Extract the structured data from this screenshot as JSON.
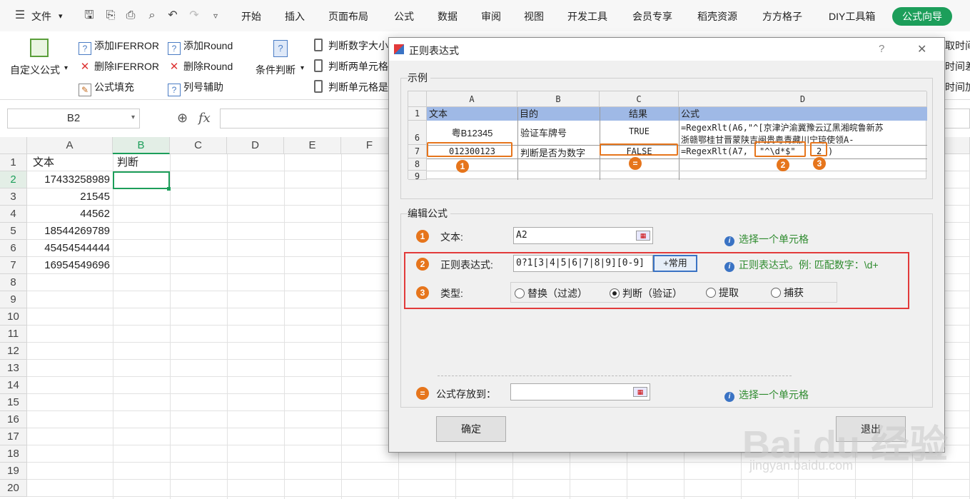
{
  "menubar": {
    "file": "文件",
    "tabs": [
      "开始",
      "插入",
      "页面布局",
      "公式",
      "数据",
      "审阅",
      "视图",
      "开发工具",
      "会员专享",
      "稻壳资源",
      "方方格子",
      "DIY工具箱"
    ],
    "active_tab": "公式向导"
  },
  "ribbon": {
    "custom_formula": "自定义公式",
    "add_iferror": "添加IFERROR",
    "del_iferror": "删除IFERROR",
    "formula_fill": "公式填充",
    "add_round": "添加Round",
    "del_round": "删除Round",
    "col_helper": "列号辅助",
    "cond_judge": "条件判断",
    "judge_num": "判断数字大小",
    "judge_two": "判断两单元格",
    "judge_cell": "判断单元格是",
    "r1": "取时间",
    "r2": "时间差",
    "r3": "时间加"
  },
  "formula_bar": {
    "name_box": "B2",
    "fx": "fx"
  },
  "sheet": {
    "columns": [
      "A",
      "B",
      "C",
      "D",
      "E",
      "F"
    ],
    "rows": [
      "1",
      "2",
      "3",
      "4",
      "5",
      "6",
      "7",
      "8",
      "9",
      "10",
      "11",
      "12",
      "13",
      "14",
      "15",
      "16",
      "17",
      "18",
      "19",
      "20"
    ],
    "header_a": "文本",
    "header_b": "判断",
    "values": [
      "17433258989",
      "21545",
      "44562",
      "18544269789",
      "45454544444",
      "16954549696"
    ]
  },
  "dialog": {
    "title": "正则表达式",
    "help": "?",
    "close": "✕",
    "example_label": "示例",
    "example": {
      "cols": [
        "A",
        "B",
        "C",
        "D"
      ],
      "row_nums": [
        "1",
        "6",
        "7",
        "8",
        "9"
      ],
      "header": [
        "文本",
        "目的",
        "结果",
        "公式"
      ],
      "row6": [
        "粤B12345",
        "验证车牌号",
        "TRUE",
        "=RegexRlt(A6,\"^[京津沪渝冀豫云辽黑湘皖鲁新苏",
        "浙赣鄂桂甘晋蒙陕吉闽贵粤青藏川宁琼使领A-"
      ],
      "row7": [
        "012300123",
        "判断是否为数字",
        "FALSE",
        "=RegexRlt(A7,",
        "\"^\\d*$\"",
        "2",
        ")"
      ],
      "badges": [
        "1",
        "=",
        "2",
        "3"
      ]
    },
    "edit_label": "编辑公式",
    "text_label": "文本:",
    "text_value": "A2",
    "text_hint": "选择一个单元格",
    "regex_label": "正则表达式:",
    "regex_value": "0?1[3|4|5|6|7|8|9][0-9]",
    "common_btn": "+常用",
    "regex_hint": "正则表达式。例:   匹配数字：\\d+",
    "type_label": "类型:",
    "types": [
      "替换（过滤）",
      "判断（验证）",
      "提取",
      "捕获"
    ],
    "selected_type": 1,
    "output_label": "公式存放到：",
    "output_value": "",
    "output_hint": "选择一个单元格",
    "ok": "确定",
    "cancel": "退出"
  },
  "watermark": {
    "main": "Bai du 经验",
    "sub": "jingyan.baidu.com"
  },
  "colors": {
    "accent": "#1c9e5a",
    "badge": "#e6751c",
    "highlight": "#e23a3a",
    "hint": "#2e8b2e"
  }
}
